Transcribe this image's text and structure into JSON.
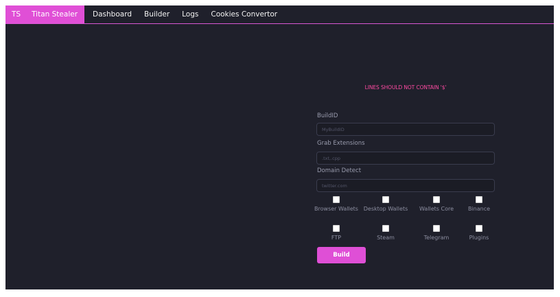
{
  "nav": {
    "brand": "TS",
    "title": "Titan Stealer",
    "links": [
      "Dashboard",
      "Builder",
      "Logs",
      "Cookies Convertor"
    ]
  },
  "form": {
    "warning": "LINES SHOULD NOT CONTAIN '$'",
    "build_id_label": "BuildID",
    "build_id_placeholder": "MyBuildID",
    "grab_label": "Grab Extensions",
    "grab_placeholder": ".txt,.cpp",
    "domain_label": "Domain Detect",
    "domain_placeholder": "twitter.com",
    "options": [
      {
        "label": "Browser Wallets",
        "checked": false
      },
      {
        "label": "Desktop Wallets",
        "checked": false
      },
      {
        "label": "Wallets Core",
        "checked": false
      },
      {
        "label": "Binance",
        "checked": false
      },
      {
        "label": "FTP",
        "checked": false
      },
      {
        "label": "Steam",
        "checked": false
      },
      {
        "label": "Telegram",
        "checked": false
      },
      {
        "label": "Plugins",
        "checked": false
      }
    ],
    "build_button": "Build"
  },
  "colors": {
    "accent": "#e04fd6",
    "background": "#1f202b",
    "warning": "#ff4aa2"
  }
}
